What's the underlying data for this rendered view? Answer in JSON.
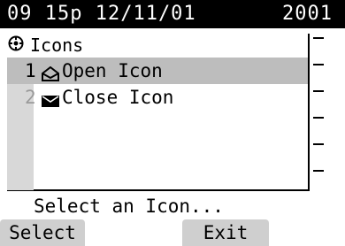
{
  "status_bar": {
    "datetime": "09 15p 12/11/01",
    "extension": "2001"
  },
  "dialog": {
    "title": "Icons",
    "title_icon": "settings-icon"
  },
  "list": {
    "items": [
      {
        "number": "1",
        "icon": "open-envelope-icon",
        "label": "Open Icon",
        "selected": true
      },
      {
        "number": "2",
        "icon": "closed-envelope-icon",
        "label": "Close Icon",
        "selected": false
      }
    ]
  },
  "prompt": "Select an Icon...",
  "softkeys": {
    "left": "Select",
    "right": "Exit"
  }
}
